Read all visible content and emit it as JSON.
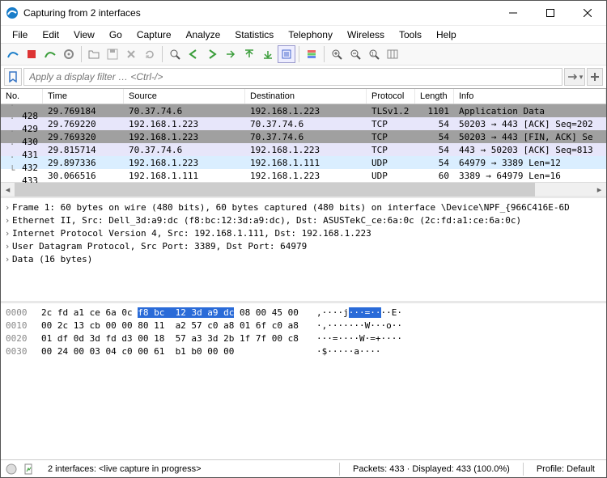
{
  "window": {
    "title": "Capturing from 2 interfaces"
  },
  "menu": [
    "File",
    "Edit",
    "View",
    "Go",
    "Capture",
    "Analyze",
    "Statistics",
    "Telephony",
    "Wireless",
    "Tools",
    "Help"
  ],
  "filter": {
    "placeholder": "Apply a display filter … <Ctrl-/>"
  },
  "columns": {
    "no": "No.",
    "time": "Time",
    "source": "Source",
    "destination": "Destination",
    "protocol": "Protocol",
    "length": "Length",
    "info": "Info"
  },
  "packets": [
    {
      "no": "428",
      "time": "29.769184",
      "src": "70.37.74.6",
      "dst": "192.168.1.223",
      "proto": "TLSv1.2",
      "len": "1101",
      "info": "Application Data",
      "cls": "row-tls"
    },
    {
      "no": "429",
      "time": "29.769220",
      "src": "192.168.1.223",
      "dst": "70.37.74.6",
      "proto": "TCP",
      "len": "54",
      "info": "50203 → 443 [ACK] Seq=202",
      "cls": "row-tcp-l"
    },
    {
      "no": "430",
      "time": "29.769320",
      "src": "192.168.1.223",
      "dst": "70.37.74.6",
      "proto": "TCP",
      "len": "54",
      "info": "50203 → 443 [FIN, ACK] Se",
      "cls": "row-tcp-d"
    },
    {
      "no": "431",
      "time": "29.815714",
      "src": "70.37.74.6",
      "dst": "192.168.1.223",
      "proto": "TCP",
      "len": "54",
      "info": "443 → 50203 [ACK] Seq=813",
      "cls": "row-tcp-l"
    },
    {
      "no": "432",
      "time": "29.897336",
      "src": "192.168.1.223",
      "dst": "192.168.1.111",
      "proto": "UDP",
      "len": "54",
      "info": "64979 → 3389 Len=12",
      "cls": "row-udp"
    },
    {
      "no": "433",
      "time": "30.066516",
      "src": "192.168.1.111",
      "dst": "192.168.1.223",
      "proto": "UDP",
      "len": "60",
      "info": "3389 → 64979 Len=16",
      "cls": "row-sel"
    }
  ],
  "details": [
    "Frame 1: 60 bytes on wire (480 bits), 60 bytes captured (480 bits) on interface \\Device\\NPF_{966C416E-6D",
    "Ethernet II, Src: Dell_3d:a9:dc (f8:bc:12:3d:a9:dc), Dst: ASUSTekC_ce:6a:0c (2c:fd:a1:ce:6a:0c)",
    "Internet Protocol Version 4, Src: 192.168.1.111, Dst: 192.168.1.223",
    "User Datagram Protocol, Src Port: 3389, Dst Port: 64979",
    "Data (16 bytes)"
  ],
  "hex": {
    "offsets": [
      "0000",
      "0010",
      "0020",
      "0030"
    ],
    "bytes": [
      {
        "pre": "2c fd a1 ce 6a 0c ",
        "hl": "f8 bc  12 3d a9 dc",
        "post": " 08 00 45 00"
      },
      {
        "pre": "00 2c 13 cb 00 00 80 11  a2 57 c0 a8 01 6f c0 a8",
        "hl": "",
        "post": ""
      },
      {
        "pre": "01 df 0d 3d fd d3 00 18  57 a3 3d 2b 1f 7f 00 c8",
        "hl": "",
        "post": ""
      },
      {
        "pre": "00 24 00 03 04 c0 00 61  b1 b0 00 00",
        "hl": "",
        "post": ""
      }
    ],
    "ascii": [
      ",····j·······E·",
      "·,·······W···o··",
      "···=····W·=+····",
      "·$·····a····"
    ],
    "ascii_hl": {
      "row": 0,
      "pre": ",····j",
      "hl": "···=··",
      "post": "··E·"
    }
  },
  "status": {
    "left": "2 interfaces: <live capture in progress>",
    "packets": "Packets: 433 · Displayed: 433 (100.0%)",
    "profile": "Profile: Default"
  }
}
